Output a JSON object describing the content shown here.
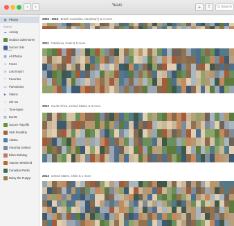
{
  "window": {
    "title": "Years",
    "back_glyph": "‹",
    "forward_glyph": "›",
    "add_glyph": "+",
    "share_glyph": "⇪",
    "search_placeholder": "Q Search"
  },
  "colors": {
    "sidebar_bg": "#f3f3f3",
    "selected_bg": "#d5dce6",
    "icon_blue": "#4a78c2"
  },
  "sidebar": {
    "top_item": {
      "label": "Photos",
      "icon": "photos-icon"
    },
    "shared_header": "Shared",
    "shared": [
      {
        "label": "Activity",
        "icon": "cloud-icon",
        "glyph": "☁"
      },
      {
        "label": "Outdoor adventures",
        "icon": "album-thumb",
        "color": "#5a8a4a"
      },
      {
        "label": "Soccer club",
        "icon": "album-thumb",
        "color": "#3b5f9a"
      }
    ],
    "albums_header": "Albums",
    "albums": [
      {
        "label": "All Photos",
        "icon": "grid-icon",
        "glyph": "▦"
      },
      {
        "label": "Faces",
        "icon": "faces-icon",
        "glyph": "☺"
      },
      {
        "label": "Last Import",
        "icon": "clock-icon",
        "glyph": "◷"
      },
      {
        "label": "Favorites",
        "icon": "heart-icon",
        "glyph": "♡"
      },
      {
        "label": "Panoramas",
        "icon": "panorama-icon",
        "glyph": "▭"
      },
      {
        "label": "Videos",
        "icon": "video-icon",
        "glyph": "▶"
      },
      {
        "label": "Slo-mo",
        "icon": "slomo-icon",
        "glyph": "◌"
      },
      {
        "label": "Time-lapse",
        "icon": "timelapse-icon",
        "glyph": "◌"
      },
      {
        "label": "Bursts",
        "icon": "bursts-icon",
        "glyph": "▤"
      },
      {
        "label": "Soccer Playoffs",
        "icon": "album-thumb",
        "color": "#6a8f3e"
      },
      {
        "label": "Utah Roadtrip",
        "icon": "album-thumb",
        "color": "#a2633a"
      },
      {
        "label": "Alaska",
        "icon": "album-thumb",
        "color": "#4d7fa8"
      },
      {
        "label": "Amazing Iceland",
        "icon": "album-thumb",
        "color": "#7a8c9c"
      },
      {
        "label": "Ella's Birthday",
        "icon": "album-thumb",
        "color": "#c47a6a"
      },
      {
        "label": "Autumn Weekend",
        "icon": "album-thumb",
        "color": "#b36b2a"
      },
      {
        "label": "Canadian Parks",
        "icon": "album-thumb",
        "color": "#3f6e4e"
      },
      {
        "label": "Daisy the Puppy!",
        "icon": "album-thumb",
        "color": "#9c7b5a"
      }
    ]
  },
  "sections": [
    {
      "year": "2009 - 2010",
      "location": "British Columbia, Namibia(?) & 4 more"
    },
    {
      "year": "2011",
      "location": "Catalonia, Kraki & 5 more"
    },
    {
      "year": "2012",
      "location": "South Africa, United States & 3 more"
    },
    {
      "year": "2013",
      "location": "United States, Chile & 1 more"
    }
  ]
}
